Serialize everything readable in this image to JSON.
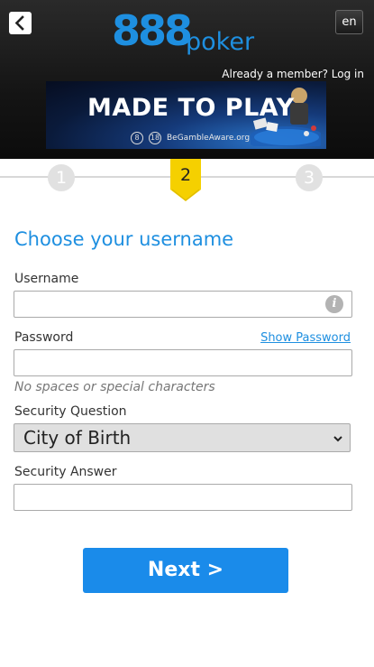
{
  "header": {
    "language": "en",
    "logo_number": "888",
    "logo_word": "poker",
    "member_link": "Already a member? Log in"
  },
  "banner": {
    "title": "MADE TO PLAY",
    "age_badge_1": "8",
    "age_badge_2": "18",
    "gamble_aware": "BeGambleAware.org"
  },
  "steps": {
    "step1": "1",
    "step2": "2",
    "step3": "3"
  },
  "form": {
    "heading": "Choose your username",
    "username_label": "Username",
    "username_value": "",
    "password_label": "Password",
    "show_password": "Show Password",
    "password_value": "",
    "password_hint": "No spaces or special characters",
    "security_question_label": "Security Question",
    "security_question_value": "City of Birth",
    "security_answer_label": "Security Answer",
    "security_answer_value": ""
  },
  "actions": {
    "next_label": "Next >"
  },
  "colors": {
    "brand_blue": "#1e8fe0",
    "button_blue": "#1a8bea",
    "step_active": "#f5d000"
  },
  "icons": {
    "back": "chevron-left-icon",
    "info": "info-icon",
    "select": "chevron-down-icon"
  }
}
